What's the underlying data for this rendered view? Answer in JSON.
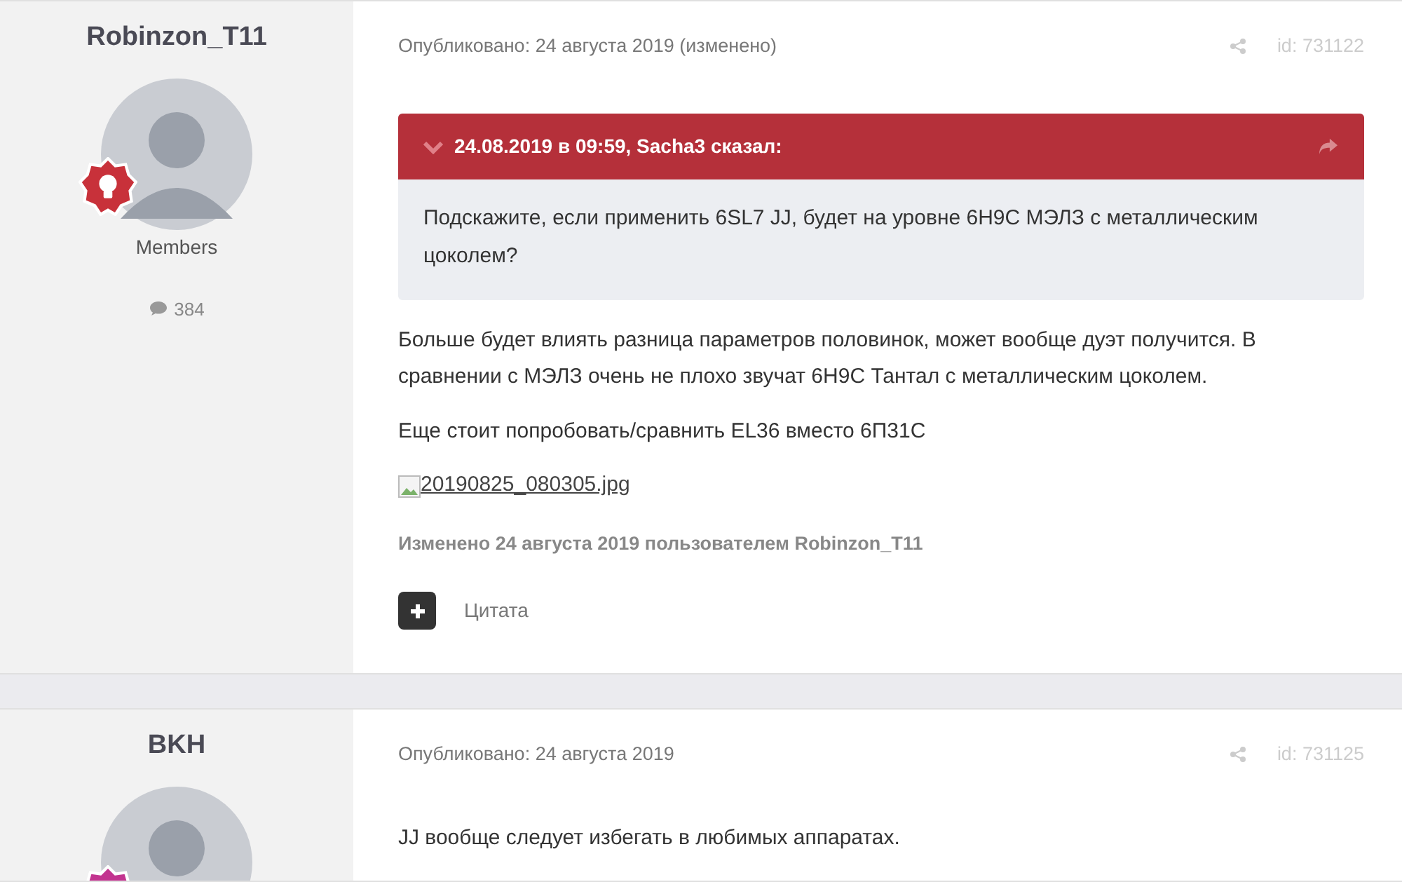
{
  "posts": [
    {
      "author": "Robinzon_T11",
      "color": "#c8313a",
      "group": "Members",
      "post_count": "384",
      "posted": "Опубликовано: 24 августа 2019 (изменено)",
      "post_id": "id: 731122",
      "quote": {
        "header": "24.08.2019 в 09:59, Sacha3 сказал:",
        "text": "Подскажите, если применить 6SL7 JJ, будет на уровне 6Н9С МЭЛЗ с металлическим цоколем?"
      },
      "paragraphs": [
        "Больше будет влиять разница  параметров половинок, может вообще дуэт получится. В сравнении с МЭЛЗ очень не плохо звучат 6Н9С Тантал с металлическим цоколем.",
        "Еще стоит попробовать/сравнить EL36 вместо 6П31С"
      ],
      "attachment": "20190825_080305.jpg",
      "edited": "Изменено 24 августа 2019 пользователем Robinzon_T11",
      "quote_action": "Цитата"
    },
    {
      "author": "BKH",
      "color": "#c2338f",
      "posted": "Опубликовано: 24 августа 2019",
      "post_id": "id: 731125",
      "paragraphs": [
        "JJ вообще следует избегать в любимых аппаратах."
      ]
    }
  ]
}
